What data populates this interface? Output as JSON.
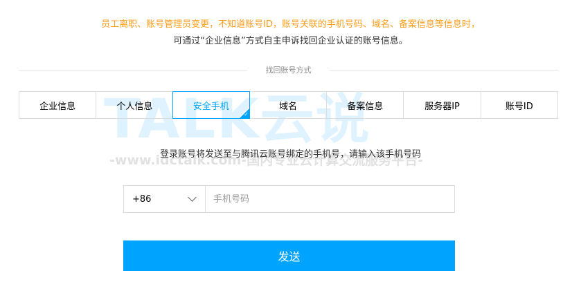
{
  "notice": {
    "warning": "员工离职、账号管理员变更，不知道账号ID，账号关联的手机号码、域名、备案信息等信息时，",
    "info": "可通过“企业信息”方式自主申诉找回企业认证的账号信息。"
  },
  "divider_label": "找回账号方式",
  "tabs": [
    {
      "label": "企业信息"
    },
    {
      "label": "个人信息"
    },
    {
      "label": "安全手机"
    },
    {
      "label": "域名"
    },
    {
      "label": "备案信息"
    },
    {
      "label": "服务器IP"
    },
    {
      "label": "账号ID"
    }
  ],
  "active_tab": "安全手机",
  "instruction": "登录账号将发送至与腾讯云账号绑定的手机号，请输入该手机号码",
  "phone": {
    "country_code": "+86",
    "placeholder": "手机号码",
    "value": ""
  },
  "send_label": "发送",
  "watermark": {
    "brand": "TALK云说",
    "url": "-www.idctalk.com-国内专业云计算交流服务平台-"
  },
  "colors": {
    "accent": "#00a4ff",
    "warning_text": "#ff9c19",
    "border": "#dddddd"
  },
  "icons": {
    "country_dropdown": "chevron-down-icon",
    "active_tab_marker": "checkmark-icon"
  }
}
